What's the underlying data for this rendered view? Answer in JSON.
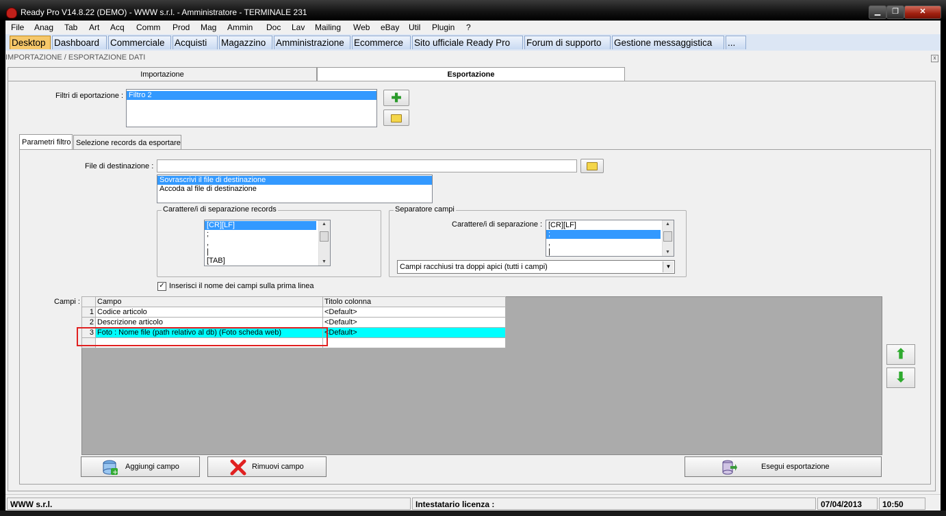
{
  "window": {
    "title": "Ready Pro V14.8.22 (DEMO) - WWW s.r.l. - Amministratore - TERMINALE 231",
    "min": "▁",
    "max": "❐",
    "close": "✕"
  },
  "menu": [
    "File",
    "Anag",
    "Tab",
    "Art",
    "Acq",
    "Comm",
    "Prod",
    "Mag",
    "Ammin",
    "Doc",
    "Lav",
    "Mailing",
    "Web",
    "eBay",
    "Util",
    "Plugin",
    "?"
  ],
  "apptabs": [
    "Desktop",
    "Dashboard",
    "Commerciale",
    "Acquisti",
    "Magazzino",
    "Amministrazione",
    "Ecommerce",
    "Sito ufficiale Ready Pro",
    "Forum di supporto",
    "Gestione messaggistica",
    "..."
  ],
  "section_title": "IMPORTAZIONE / ESPORTAZIONE DATI",
  "section_close": "x",
  "top_tabs": {
    "import": "Importazione",
    "export": "Esportazione"
  },
  "filters": {
    "label": "Filtri di eportazione :",
    "items": [
      "Filtro 2"
    ]
  },
  "inner_tabs": {
    "params": "Parametri filtro",
    "selection": "Selezione records da esportare"
  },
  "dest": {
    "label": "File di destinazione :",
    "value": "",
    "modes": [
      "Sovrascrivi il file di destinazione",
      "Accoda al file di destinazione"
    ]
  },
  "record_sep": {
    "title": "Carattere/i di separazione records",
    "items": [
      "[CR][LF]",
      ";",
      ",",
      "|",
      "[TAB]"
    ]
  },
  "field_sep": {
    "title": "Separatore campi",
    "label": "Carattere/i di separazione :",
    "items": [
      "[CR][LF]",
      ";",
      ",",
      "|"
    ],
    "quote_option": "Campi racchiusi tra doppi apici (tutti i campi)"
  },
  "header_checkbox": {
    "label": "Inserisci il nome dei campi sulla prima linea",
    "checked": true,
    "mark": "✓"
  },
  "fields": {
    "label": "Campi :",
    "columns": [
      "",
      "Campo",
      "Titolo colonna"
    ],
    "rows": [
      {
        "n": "1",
        "campo": "Codice articolo",
        "titolo": "<Default>"
      },
      {
        "n": "2",
        "campo": "Descrizione articolo",
        "titolo": "<Default>"
      },
      {
        "n": "3",
        "campo": "Foto : Nome file (path relativo al db) (Foto scheda web)",
        "titolo": "<Default>"
      }
    ],
    "highlighted_row": 3,
    "highlight_color": "#00ffff"
  },
  "buttons": {
    "add": "Aggiungi campo",
    "remove": "Rimuovi campo",
    "run": "Esegui esportazione",
    "up": "⬆",
    "down": "⬇"
  },
  "icons": {
    "add_filter": "plus-icon",
    "open_filter": "folder-icon",
    "browse": "folder-icon",
    "add_field": "database-add-icon",
    "remove_field": "red-x-icon",
    "run": "database-export-icon"
  },
  "status": {
    "company": "WWW s.r.l.",
    "license": "Intestatario licenza :",
    "date": "07/04/2013",
    "time": "10:50"
  }
}
